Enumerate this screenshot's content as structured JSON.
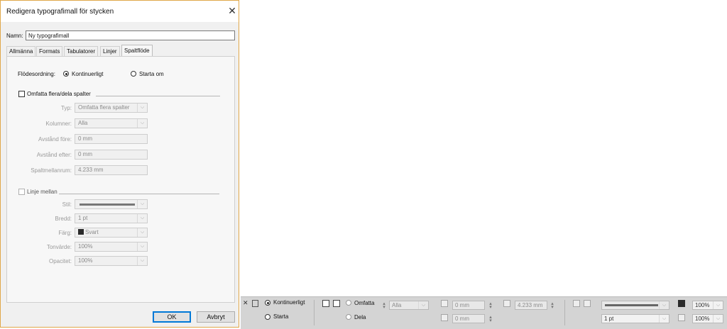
{
  "dialog": {
    "title": "Redigera typografimall för stycken",
    "close_glyph": "✕",
    "name_label": "Namn:",
    "name_value": "Ny typografimall",
    "tabs": [
      "Allmänna",
      "Formats",
      "Tabulatorer",
      "Linjer",
      "Spaltflöde"
    ],
    "active_tab": "Spaltflöde",
    "flow_label": "Flödesordning:",
    "flow_options": [
      "Kontinuerligt",
      "Starta om"
    ],
    "flow_selected": "Kontinuerligt",
    "span": {
      "checkbox_label": "Omfatta flera/dela spalter",
      "checked": false,
      "rows": [
        {
          "label": "Typ:",
          "value": "Omfatta flera spalter",
          "kind": "dropdown"
        },
        {
          "label": "Kolumner:",
          "value": "Alla",
          "kind": "dropdown"
        },
        {
          "label": "Avstånd före:",
          "value": "0 mm",
          "kind": "text"
        },
        {
          "label": "Avstånd efter:",
          "value": "0 mm",
          "kind": "text"
        },
        {
          "label": "Spaltmellanrum:",
          "value": "4.233 mm",
          "kind": "text"
        }
      ]
    },
    "rule": {
      "checkbox_label": "Linje mellan",
      "checked": false,
      "rows": [
        {
          "label": "Stil:",
          "value": "",
          "kind": "dropdown"
        },
        {
          "label": "Bredd:",
          "value": "1 pt",
          "kind": "dropdown"
        },
        {
          "label": "Färg:",
          "value": "Svart",
          "kind": "dropdown"
        },
        {
          "label": "Tonvärde:",
          "value": "100%",
          "kind": "dropdown"
        },
        {
          "label": "Opacitet:",
          "value": "100%",
          "kind": "dropdown"
        }
      ]
    },
    "ok_label": "OK",
    "cancel_label": "Avbryt"
  },
  "control_bar": {
    "continuous_label": "Kontinuerligt",
    "restart_label": "Starta",
    "span_label": "Omfatta",
    "split_label": "Dela",
    "columns_value": "Alla",
    "space_before": "0 mm",
    "space_after": "0 mm",
    "gutter": "4.233 mm",
    "rule_weight": "1 pt",
    "tint": "100%",
    "opacity": "100%",
    "gap_tint": "100%",
    "gap_opacity": "100%"
  },
  "colors": {
    "dialog_border": "#e0a84a",
    "swatch_black": "#2b2b2b"
  }
}
